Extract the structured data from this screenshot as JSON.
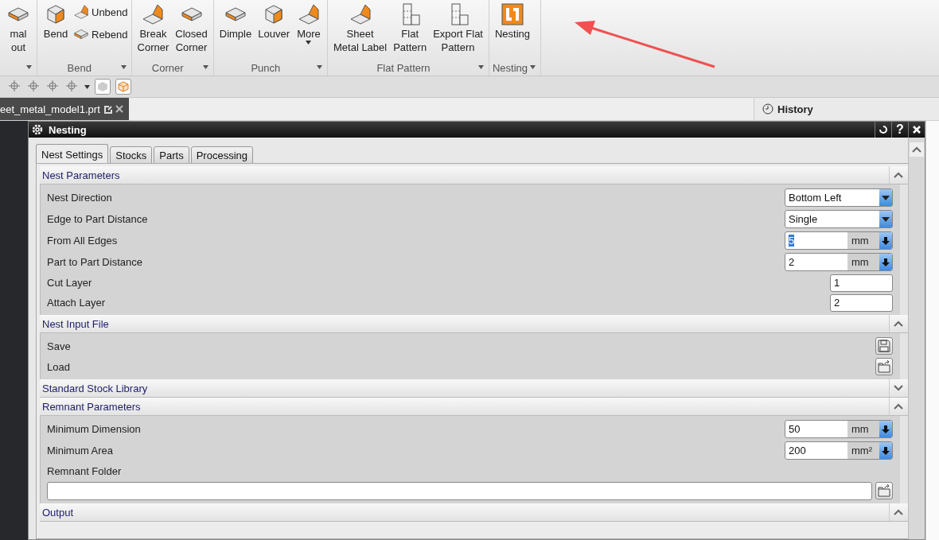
{
  "ribbon": {
    "groups": [
      {
        "dropdown": true,
        "buttons": [
          {
            "lines": [
              "mal",
              "out"
            ],
            "kind": "large"
          }
        ]
      },
      {
        "label": "Bend",
        "dropdown": true,
        "buttons": [
          {
            "lines": [
              "Bend"
            ],
            "kind": "large"
          },
          {
            "lines": [
              "Unbend"
            ],
            "kind": "small"
          },
          {
            "lines": [
              "Rebend"
            ],
            "kind": "small"
          }
        ]
      },
      {
        "label": "Corner",
        "dropdown": true,
        "buttons": [
          {
            "lines": [
              "Break",
              "Corner"
            ],
            "kind": "large"
          },
          {
            "lines": [
              "Closed",
              "Corner"
            ],
            "kind": "large"
          }
        ]
      },
      {
        "label": "Punch",
        "dropdown": true,
        "buttons": [
          {
            "lines": [
              "Dimple"
            ],
            "kind": "large"
          },
          {
            "lines": [
              "Louver"
            ],
            "kind": "large"
          },
          {
            "lines": [
              "More"
            ],
            "kind": "large",
            "menu": true
          }
        ]
      },
      {
        "label": "Flat Pattern",
        "dropdown": true,
        "buttons": [
          {
            "lines": [
              "Sheet",
              "Metal Label"
            ],
            "kind": "large"
          },
          {
            "lines": [
              "Flat",
              "Pattern"
            ],
            "kind": "large"
          },
          {
            "lines": [
              "Export Flat",
              "Pattern"
            ],
            "kind": "large"
          }
        ]
      },
      {
        "label": "Nesting",
        "dropdown": true,
        "buttons": [
          {
            "lines": [
              "Nesting"
            ],
            "kind": "large"
          }
        ]
      }
    ]
  },
  "file_tab": {
    "label": "eet_metal_model1.prt"
  },
  "history_tab": {
    "label": "History"
  },
  "dialog": {
    "title": "Nesting",
    "help_button": "?",
    "tabs": [
      {
        "label": "Nest Settings",
        "selected": true
      },
      {
        "label": "Stocks",
        "selected": false
      },
      {
        "label": "Parts",
        "selected": false
      },
      {
        "label": "Processing",
        "selected": false
      }
    ],
    "sections": [
      {
        "title": "Nest Parameters",
        "expanded": true,
        "rows": [
          {
            "kind": "select",
            "label": "Nest Direction",
            "value": "Bottom Left"
          },
          {
            "kind": "select",
            "label": "Edge to Part Distance",
            "value": "Single"
          },
          {
            "kind": "unit",
            "label": "From All Edges",
            "value": "5",
            "unit": "mm",
            "text_selected": true
          },
          {
            "kind": "unit",
            "label": "Part to Part Distance",
            "value": "2",
            "unit": "mm",
            "text_selected": false
          },
          {
            "kind": "number",
            "label": "Cut Layer",
            "value": "1"
          },
          {
            "kind": "number",
            "label": "Attach Layer",
            "value": "2"
          }
        ]
      },
      {
        "title": "Nest Input File",
        "expanded": true,
        "rows": [
          {
            "kind": "save",
            "label": "Save"
          },
          {
            "kind": "open",
            "label": "Load"
          }
        ]
      },
      {
        "title": "Standard Stock Library",
        "expanded": false
      },
      {
        "title": "Remnant Parameters",
        "expanded": true,
        "rows": [
          {
            "kind": "unit",
            "label": "Minimum Dimension",
            "value": "50",
            "unit": "mm",
            "text_selected": false
          },
          {
            "kind": "unit",
            "label": "Minimum Area",
            "value": "200",
            "unit": "mm²",
            "text_selected": false
          },
          {
            "kind": "folder",
            "label": "Remnant Folder"
          }
        ]
      },
      {
        "title": "Output",
        "expanded": true
      }
    ]
  }
}
